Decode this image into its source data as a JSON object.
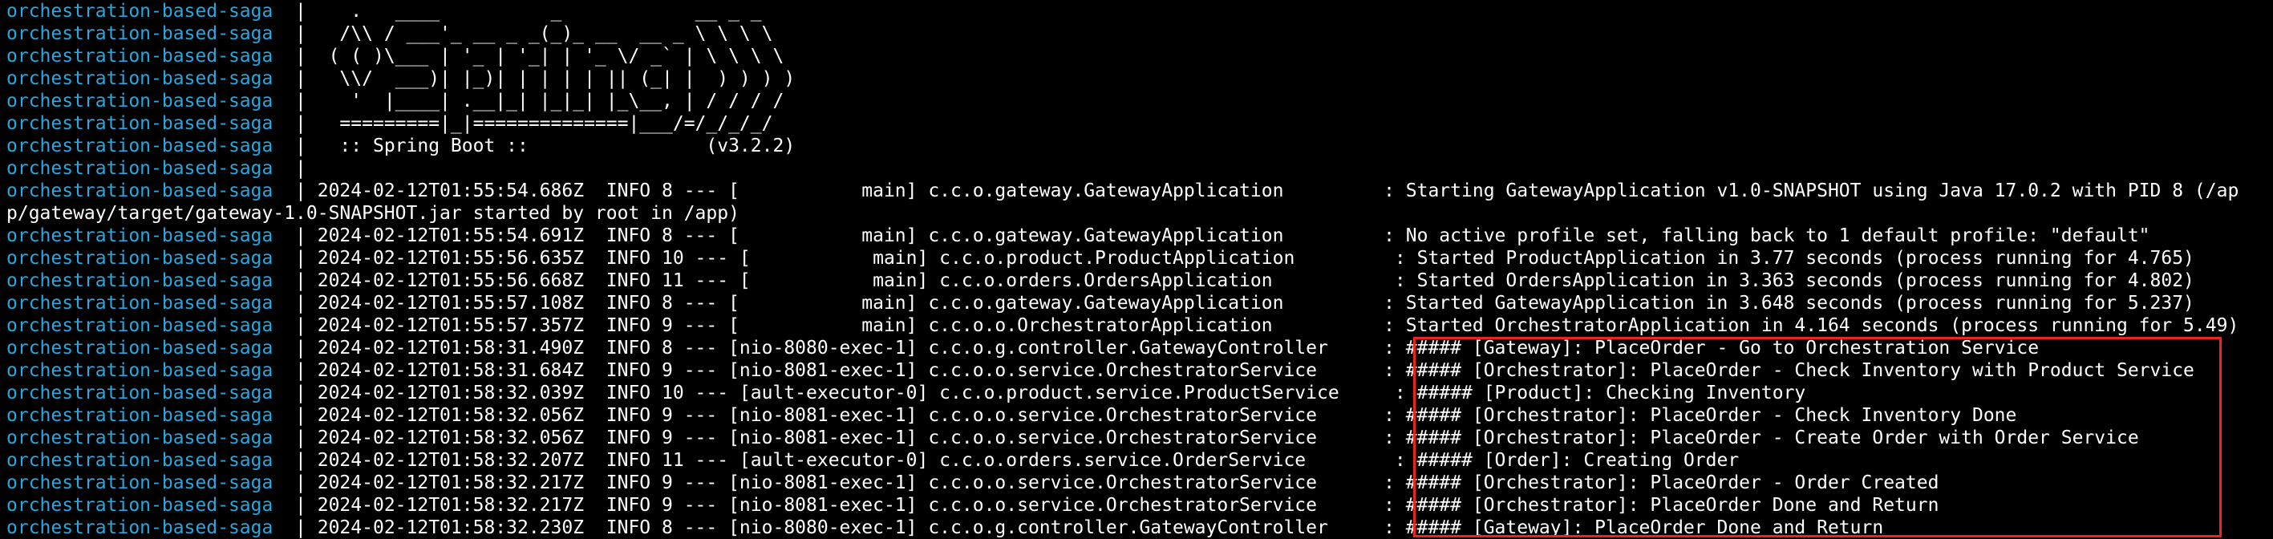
{
  "terminal": {
    "colors": {
      "background": "#000000",
      "prefix": "#29a7e0",
      "text": "#ffffff",
      "highlight_border": "#ee2222"
    },
    "lines": [
      {
        "prefix": "orchestration-based-saga",
        "sep": "  |",
        "msg": "    .   ____          _            __ _ _"
      },
      {
        "prefix": "orchestration-based-saga",
        "sep": "  |",
        "msg": "   /\\\\ / ___'_ __ _ _(_)_ __  __ _ \\ \\ \\ \\"
      },
      {
        "prefix": "orchestration-based-saga",
        "sep": "  |",
        "msg": "  ( ( )\\___ | '_ | '_| | '_ \\/ _` | \\ \\ \\ \\"
      },
      {
        "prefix": "orchestration-based-saga",
        "sep": "  |",
        "msg": "   \\\\/  ___)| |_)| | | | | || (_| |  ) ) ) )"
      },
      {
        "prefix": "orchestration-based-saga",
        "sep": "  |",
        "msg": "    '  |____| .__|_| |_|_| |_\\__, | / / / /"
      },
      {
        "prefix": "orchestration-based-saga",
        "sep": "  |",
        "msg": "   =========|_|==============|___/=/_/_/_/"
      },
      {
        "prefix": "orchestration-based-saga",
        "sep": "  |",
        "msg": "   :: Spring Boot ::                (v3.2.2)"
      },
      {
        "prefix": "orchestration-based-saga",
        "sep": "  |",
        "msg": ""
      },
      {
        "prefix": "orchestration-based-saga",
        "sep": "  |",
        "msg": " 2024-02-12T01:55:54.686Z  INFO 8 --- [           main] c.c.o.gateway.GatewayApplication         : Starting GatewayApplication v1.0-SNAPSHOT using Java 17.0.2 with PID 8 (/ap"
      },
      {
        "prefix": "",
        "sep": "",
        "msg": "p/gateway/target/gateway-1.0-SNAPSHOT.jar started by root in /app)"
      },
      {
        "prefix": "orchestration-based-saga",
        "sep": "  |",
        "msg": " 2024-02-12T01:55:54.691Z  INFO 8 --- [           main] c.c.o.gateway.GatewayApplication         : No active profile set, falling back to 1 default profile: \"default\""
      },
      {
        "prefix": "orchestration-based-saga",
        "sep": "  |",
        "msg": " 2024-02-12T01:55:56.635Z  INFO 10 --- [           main] c.c.o.product.ProductApplication         : Started ProductApplication in 3.77 seconds (process running for 4.765)"
      },
      {
        "prefix": "orchestration-based-saga",
        "sep": "  |",
        "msg": " 2024-02-12T01:55:56.668Z  INFO 11 --- [           main] c.c.o.orders.OrdersApplication           : Started OrdersApplication in 3.363 seconds (process running for 4.802)"
      },
      {
        "prefix": "orchestration-based-saga",
        "sep": "  |",
        "msg": " 2024-02-12T01:55:57.108Z  INFO 8 --- [           main] c.c.o.gateway.GatewayApplication         : Started GatewayApplication in 3.648 seconds (process running for 5.237)"
      },
      {
        "prefix": "orchestration-based-saga",
        "sep": "  |",
        "msg": " 2024-02-12T01:55:57.357Z  INFO 9 --- [           main] c.c.o.o.OrchestratorApplication          : Started OrchestratorApplication in 4.164 seconds (process running for 5.49)"
      },
      {
        "prefix": "orchestration-based-saga",
        "sep": "  |",
        "msg": " 2024-02-12T01:58:31.490Z  INFO 8 --- [nio-8080-exec-1] c.c.o.g.controller.GatewayController     : ##### [Gateway]: PlaceOrder - Go to Orchestration Service"
      },
      {
        "prefix": "orchestration-based-saga",
        "sep": "  |",
        "msg": " 2024-02-12T01:58:31.684Z  INFO 9 --- [nio-8081-exec-1] c.c.o.o.service.OrchestratorService      : ##### [Orchestrator]: PlaceOrder - Check Inventory with Product Service"
      },
      {
        "prefix": "orchestration-based-saga",
        "sep": "  |",
        "msg": " 2024-02-12T01:58:32.039Z  INFO 10 --- [ault-executor-0] c.c.o.product.service.ProductService     : ##### [Product]: Checking Inventory"
      },
      {
        "prefix": "orchestration-based-saga",
        "sep": "  |",
        "msg": " 2024-02-12T01:58:32.056Z  INFO 9 --- [nio-8081-exec-1] c.c.o.o.service.OrchestratorService      : ##### [Orchestrator]: PlaceOrder - Check Inventory Done"
      },
      {
        "prefix": "orchestration-based-saga",
        "sep": "  |",
        "msg": " 2024-02-12T01:58:32.056Z  INFO 9 --- [nio-8081-exec-1] c.c.o.o.service.OrchestratorService      : ##### [Orchestrator]: PlaceOrder - Create Order with Order Service"
      },
      {
        "prefix": "orchestration-based-saga",
        "sep": "  |",
        "msg": " 2024-02-12T01:58:32.207Z  INFO 11 --- [ault-executor-0] c.c.o.orders.service.OrderService        : ##### [Order]: Creating Order"
      },
      {
        "prefix": "orchestration-based-saga",
        "sep": "  |",
        "msg": " 2024-02-12T01:58:32.217Z  INFO 9 --- [nio-8081-exec-1] c.c.o.o.service.OrchestratorService      : ##### [Orchestrator]: PlaceOrder - Order Created"
      },
      {
        "prefix": "orchestration-based-saga",
        "sep": "  |",
        "msg": " 2024-02-12T01:58:32.217Z  INFO 9 --- [nio-8081-exec-1] c.c.o.o.service.OrchestratorService      : ##### [Orchestrator]: PlaceOrder Done and Return"
      },
      {
        "prefix": "orchestration-based-saga",
        "sep": "  |",
        "msg": " 2024-02-12T01:58:32.230Z  INFO 8 --- [nio-8080-exec-1] c.c.o.g.controller.GatewayController     : ##### [Gateway]: PlaceOrder Done and Return"
      }
    ]
  }
}
